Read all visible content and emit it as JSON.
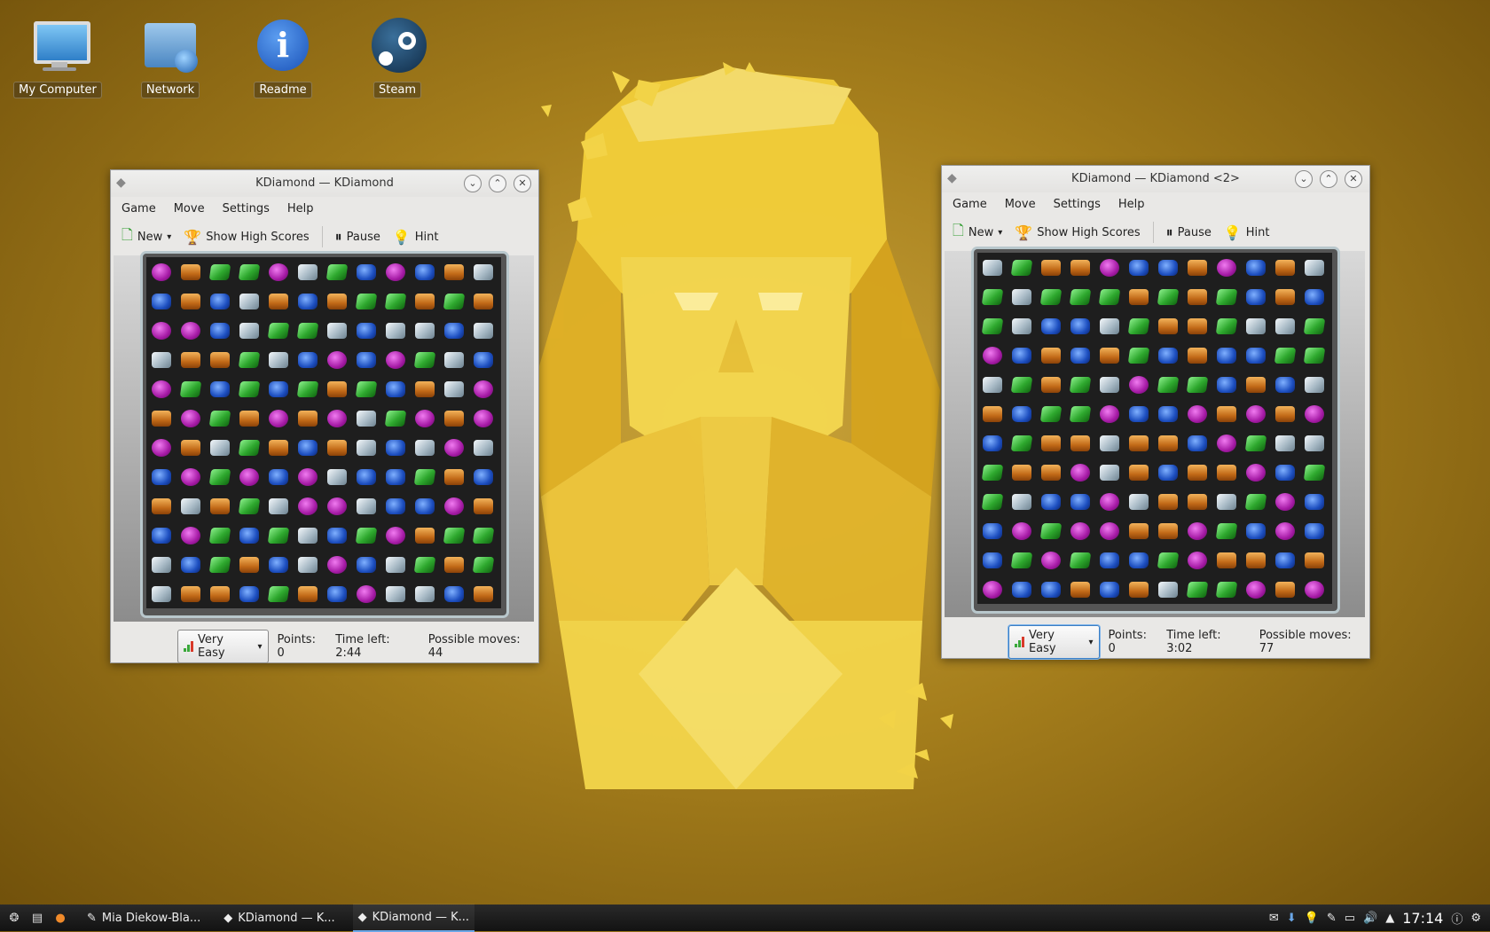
{
  "desktop": {
    "icons": [
      {
        "label": "My Computer",
        "icon": "computer-icon"
      },
      {
        "label": "Network",
        "icon": "network-folder-icon"
      },
      {
        "label": "Readme",
        "icon": "info-icon"
      },
      {
        "label": "Steam",
        "icon": "steam-icon"
      }
    ]
  },
  "windows": [
    {
      "title": "KDiamond — KDiamond",
      "menu": [
        "Game",
        "Move",
        "Settings",
        "Help"
      ],
      "toolbar": {
        "new": "New",
        "scores": "Show High Scores",
        "pause": "Pause",
        "hint": "Hint"
      },
      "difficulty": "Very Easy",
      "status": {
        "points": "Points: 0",
        "time": "Time left: 2:44",
        "moves": "Possible moves: 44"
      },
      "board": [
        "POGGPWGBPBOW",
        "BOBWOBOGGOGO",
        "PPBWGGWBWWBW",
        "WOOGWBPBPGWB",
        "PGBGBGOGBOWP",
        "OPGOPOPWGPOP",
        "POWGOBOWBWPW",
        "BPGPBPWBBGOB",
        "OWOGWPPWBBPO",
        "BPGBGWBGPOGG",
        "WBGOBWPBWGOG",
        "WOOBGOBPWWBO"
      ]
    },
    {
      "title": "KDiamond — KDiamond <2>",
      "menu": [
        "Game",
        "Move",
        "Settings",
        "Help"
      ],
      "toolbar": {
        "new": "New",
        "scores": "Show High Scores",
        "pause": "Pause",
        "hint": "Hint"
      },
      "difficulty": "Very Easy",
      "status": {
        "points": "Points: 0",
        "time": "Time left: 3:02",
        "moves": "Possible moves: 77"
      },
      "board": [
        "WGOOPBBOPBOW",
        "GWGGGOGOGBOB",
        "GWBBWGOOGWWG",
        "PBOBOGBOBBGG",
        "WGOGWPGGBOBW",
        "OBGGPBBPOPOP",
        "BGOOWOOBPGWW",
        "GOOPWOBOOPBG",
        "GWBBPWOOWGPB",
        "BPGPPOOPGBPB",
        "BGPGBBGPOOBO",
        "PBBOBOWGGPOP"
      ]
    }
  ],
  "taskbar": {
    "tasks": [
      {
        "label": "Mia Diekow-Bla..."
      },
      {
        "label": "KDiamond — K..."
      },
      {
        "label": "KDiamond — K..."
      }
    ],
    "clock": "17:14"
  },
  "colors": {
    "accent": "#3c7fc4",
    "taskbar": "#1a1a1a"
  }
}
